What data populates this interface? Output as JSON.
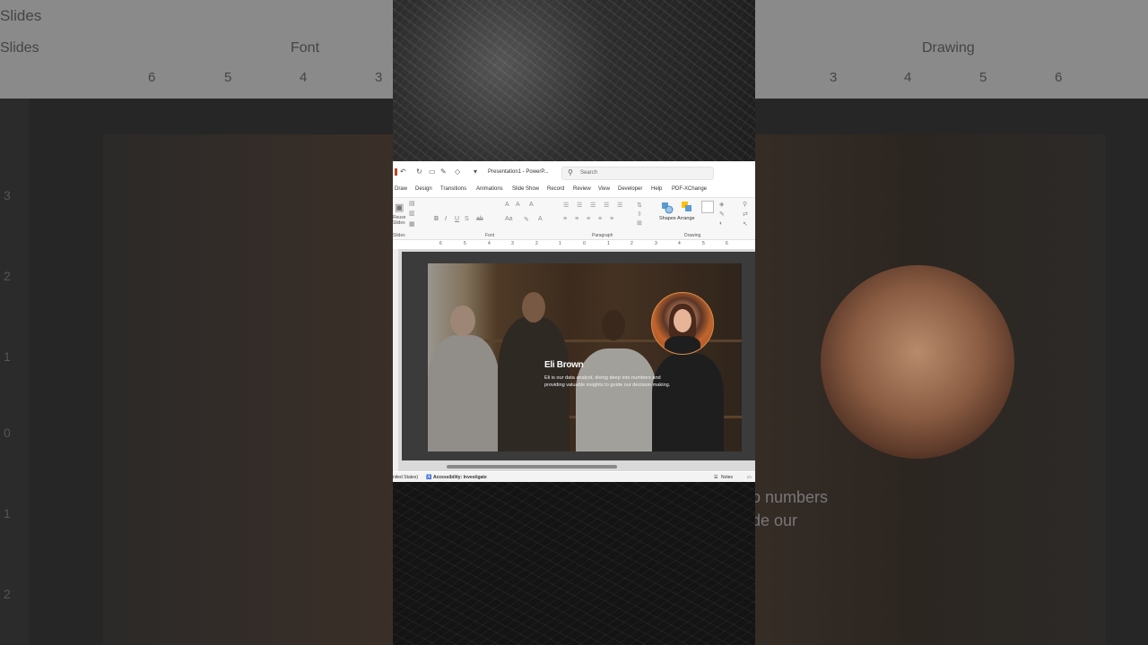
{
  "background": {
    "ribbon_labels": [
      "Slides",
      "Font",
      "Drawing"
    ],
    "ruler_numbers": [
      "6",
      "5",
      "4",
      "3",
      "3",
      "4",
      "5",
      "6"
    ],
    "vertical_ruler": [
      "3",
      "2",
      "1",
      "0",
      "1",
      "2"
    ],
    "overlay_text": [
      "o numbers",
      "de our"
    ]
  },
  "titlebar": {
    "document_title": "Presentation1 - PowerP...",
    "search_placeholder": "Search"
  },
  "tabs": [
    "Draw",
    "Design",
    "Transitions",
    "Animations",
    "Slide Show",
    "Record",
    "Review",
    "View",
    "Developer",
    "Help",
    "PDF-XChange"
  ],
  "ribbon": {
    "groups": {
      "slides": "Slides",
      "font": "Font",
      "paragraph": "Paragraph",
      "drawing": "Drawing"
    },
    "reuse_slides": "Reuse Slides",
    "shapes": "Shapes",
    "arrange": "Arrange"
  },
  "hruler": [
    "6",
    "5",
    "4",
    "3",
    "2",
    "1",
    "0",
    "1",
    "2",
    "3",
    "4",
    "5",
    "6"
  ],
  "slide": {
    "name": "Eli Brown",
    "description": "Eli is our data analyst, diving deep into numbers and providing valuable insights to guide our decision-making."
  },
  "statusbar": {
    "language": "nited States)",
    "accessibility": "Accessibility: Investigate",
    "notes": "Notes"
  },
  "colors": {
    "accent_circle_border": "#d98d4a",
    "slide_bg": "#3b3b3b"
  }
}
